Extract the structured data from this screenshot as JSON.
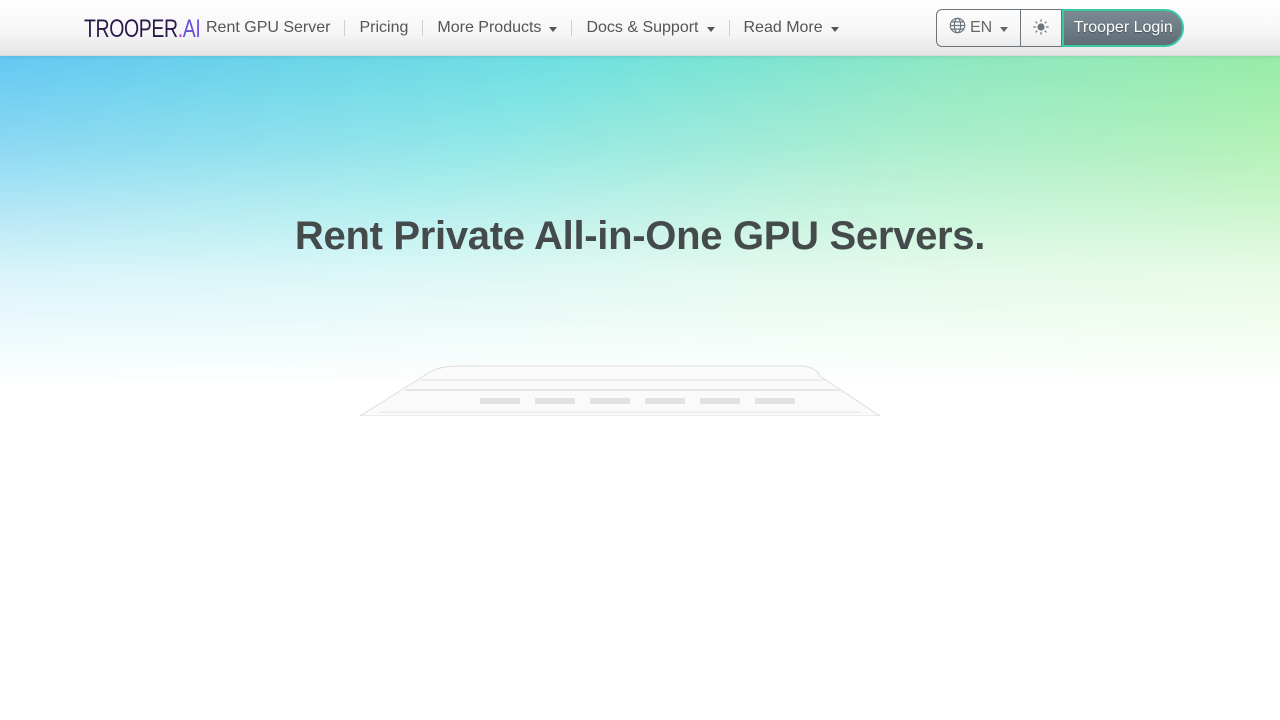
{
  "brand": {
    "part1": "TROOPER",
    "part2": ".",
    "part3": "A",
    "part4": "I"
  },
  "nav": {
    "items": [
      {
        "label": "Rent GPU Server",
        "dropdown": false
      },
      {
        "label": "Pricing",
        "dropdown": false
      },
      {
        "label": "More Products",
        "dropdown": true
      },
      {
        "label": "Docs & Support",
        "dropdown": true
      },
      {
        "label": "Read More",
        "dropdown": true
      }
    ]
  },
  "language": {
    "selected": "EN",
    "icon": "globe-icon"
  },
  "theme_toggle": {
    "icon": "sun-icon"
  },
  "login": {
    "label": "Trooper Login"
  },
  "hero": {
    "title": "Rent Private All-in-One GPU Servers."
  },
  "colors": {
    "hero_gradient": [
      "#64c8f2",
      "#6ee0e0",
      "#8ee8c0",
      "#a2f08a"
    ],
    "login_border": "#3cc8a6",
    "login_bg": "#6c7a83",
    "title_text": "#454a4a"
  }
}
